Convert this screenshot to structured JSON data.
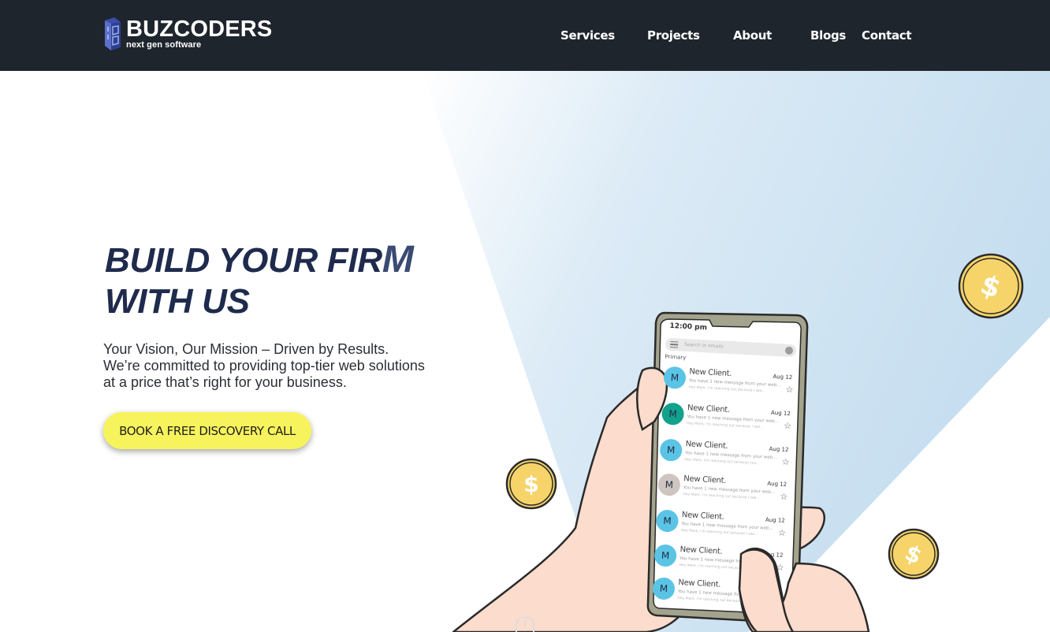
{
  "brand": {
    "name": "BUZCODERS",
    "tagline": "next gen software"
  },
  "nav": {
    "items": [
      {
        "label": "Services"
      },
      {
        "label": "Projects"
      },
      {
        "label": "About"
      },
      {
        "label": "Blogs"
      },
      {
        "label": "Contact"
      }
    ]
  },
  "hero": {
    "headline_line1": "BUILD YOUR FIR",
    "headline_line1_last": "M",
    "headline_line2": "WITH US",
    "subtext_line1": "Your Vision, Our Mission – Driven by Results.",
    "subtext_line2": "We’re committed to providing top-tier web solutions",
    "subtext_line3": "at a price that’s right for your business.",
    "cta_label": "BOOK A FREE DISCOVERY CALL"
  },
  "phone": {
    "time": "12:00 pm",
    "search_placeholder": "Search in emails",
    "section": "Primary",
    "emails": [
      {
        "initial": "M",
        "sender": "New Client.",
        "date": "Aug 12",
        "preview": "You have 1 new message from your web...",
        "snippet": "Hey Mark, I'm reaching out because I see...",
        "avatar_color": "#5bc4e6"
      },
      {
        "initial": "M",
        "sender": "New Client.",
        "date": "Aug 12",
        "preview": "You have 1 new message from your web...",
        "snippet": "Hey Mark, I'm reaching out because I see...",
        "avatar_color": "#12a18c"
      },
      {
        "initial": "M",
        "sender": "New Client.",
        "date": "Aug 12",
        "preview": "You have 1 new message from your web...",
        "snippet": "Hey Mark, I'm reaching out because you...",
        "avatar_color": "#5bc4e6"
      },
      {
        "initial": "M",
        "sender": "New Client.",
        "date": "Aug 12",
        "preview": "You have 1 new message from your web...",
        "snippet": "Hey Mark, I'm reaching out because I see...",
        "avatar_color": "#cfc5c0"
      },
      {
        "initial": "M",
        "sender": "New Client.",
        "date": "Aug 12",
        "preview": "You have 1 new message from your web...",
        "snippet": "Hey Mark, I'm reaching out because I see...",
        "avatar_color": "#5bc4e6"
      },
      {
        "initial": "M",
        "sender": "New Client.",
        "date": "Aug 12",
        "preview": "You have 1 new message from your web...",
        "snippet": "Hey Mark, I'm reaching out because I see...",
        "avatar_color": "#5bc4e6"
      },
      {
        "initial": "M",
        "sender": "New Client.",
        "date": "Aug 12",
        "preview": "You have 1 new message from your web...",
        "snippet": "Hey Mark, I'm reaching out because I see...",
        "avatar_color": "#5bc4e6"
      }
    ]
  },
  "colors": {
    "nav_bg": "#1f252d",
    "headline": "#1f2b4d",
    "cta_bg": "#f7f35d",
    "panel_blue": "#c9e0f0",
    "coin": "#f6d46a",
    "skin": "#fcdccc"
  },
  "icons": {
    "logo": "building-logo-icon",
    "coin": "dollar-coin-icon",
    "star": "star-outline-icon",
    "menu": "hamburger-menu-icon"
  }
}
